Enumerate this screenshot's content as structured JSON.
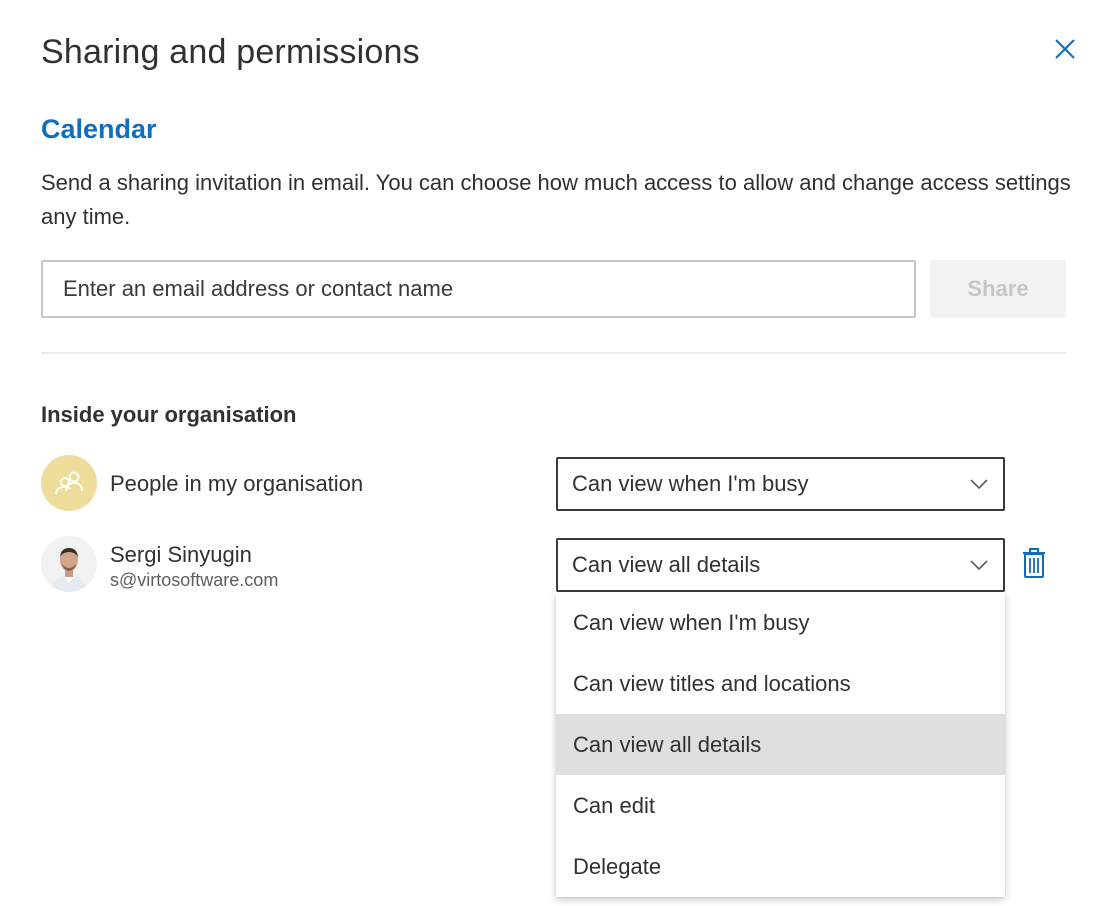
{
  "dialog": {
    "title": "Sharing and permissions",
    "close_icon": "close-icon"
  },
  "calendar": {
    "name": "Calendar",
    "description": "Send a sharing invitation in email. You can choose how much access to allow and change access settings any time."
  },
  "invite": {
    "placeholder": "Enter an email address or contact name",
    "value": "",
    "share_label": "Share",
    "share_enabled": false
  },
  "inside_org": {
    "title": "Inside your organisation",
    "rows": [
      {
        "name": "People in my organisation",
        "avatar_icon": "people-group-icon",
        "permission": "Can view when I'm busy"
      },
      {
        "name": "Sergi Sinyugin",
        "email": "s@virtosoftware.com",
        "avatar_icon": "user-photo",
        "permission": "Can view all details",
        "delete_icon": "trash-icon"
      }
    ]
  },
  "permission_menu": {
    "open": true,
    "selected": "Can view all details",
    "options": [
      "Can view when I'm busy",
      "Can view titles and locations",
      "Can view all details",
      "Can edit",
      "Delegate"
    ]
  },
  "colors": {
    "accent": "#106ebe",
    "text": "#323130",
    "selected_item_bg": "#e1dfdd",
    "org_avatar_bg": "#eedc9a"
  }
}
